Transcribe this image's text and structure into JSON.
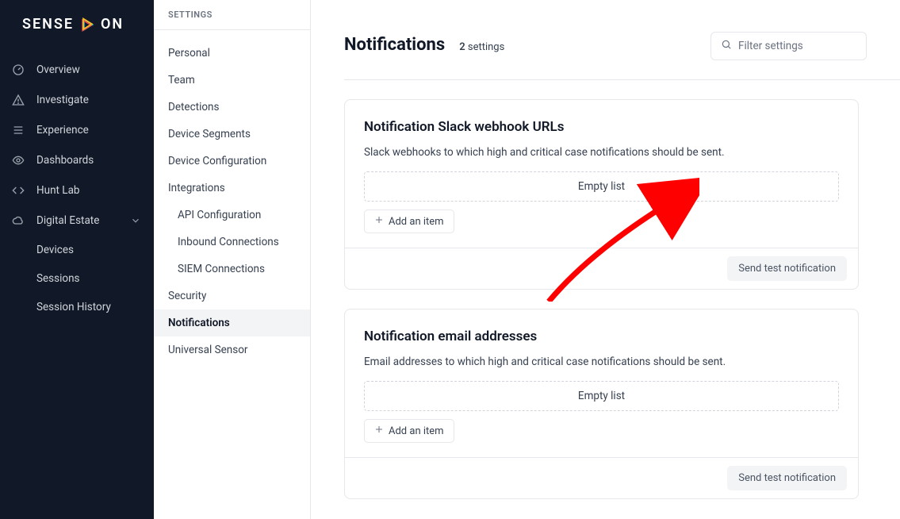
{
  "brand": {
    "left": "SENSE",
    "right": "ON"
  },
  "nav": {
    "items": [
      {
        "label": "Overview"
      },
      {
        "label": "Investigate"
      },
      {
        "label": "Experience"
      },
      {
        "label": "Dashboards"
      },
      {
        "label": "Hunt Lab"
      },
      {
        "label": "Digital Estate",
        "expanded": true,
        "children": [
          {
            "label": "Devices"
          },
          {
            "label": "Sessions"
          },
          {
            "label": "Session History"
          }
        ]
      }
    ]
  },
  "settings_col": {
    "header": "SETTINGS",
    "items": [
      {
        "label": "Personal"
      },
      {
        "label": "Team"
      },
      {
        "label": "Detections"
      },
      {
        "label": "Device Segments"
      },
      {
        "label": "Device Configuration"
      },
      {
        "label": "Integrations",
        "children": [
          {
            "label": "API Configuration"
          },
          {
            "label": "Inbound Connections"
          },
          {
            "label": "SIEM Connections"
          }
        ]
      },
      {
        "label": "Security"
      },
      {
        "label": "Notifications",
        "active": true
      },
      {
        "label": "Universal Sensor"
      }
    ]
  },
  "main": {
    "title": "Notifications",
    "count_num": "2",
    "count_label": "settings",
    "filter_placeholder": "Filter settings",
    "cards": [
      {
        "title": "Notification Slack webhook URLs",
        "desc": "Slack webhooks to which high and critical case notifications should be sent.",
        "empty_label": "Empty list",
        "add_label": "Add an item",
        "test_label": "Send test notification"
      },
      {
        "title": "Notification email addresses",
        "desc": "Email addresses to which high and critical case notifications should be sent.",
        "empty_label": "Empty list",
        "add_label": "Add an item",
        "test_label": "Send test notification"
      }
    ]
  }
}
